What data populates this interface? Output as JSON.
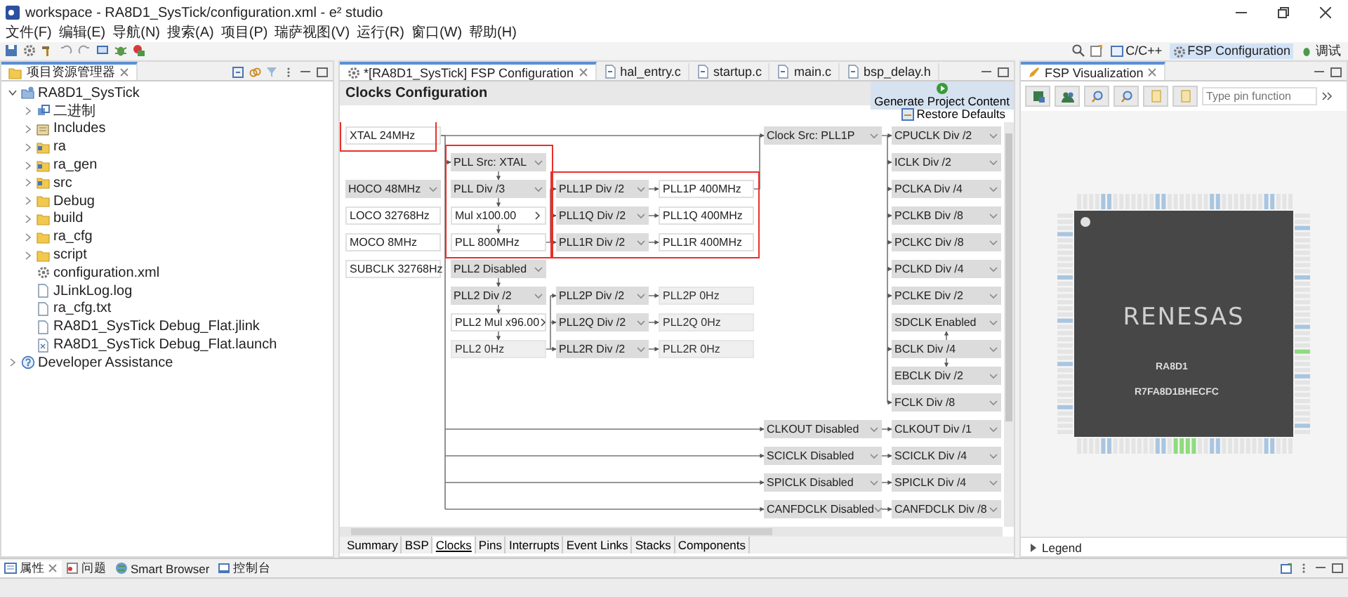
{
  "window": {
    "title": "workspace - RA8D1_SysTick/configuration.xml - e² studio"
  },
  "menu": [
    "文件(F)",
    "编辑(E)",
    "导航(N)",
    "搜索(A)",
    "项目(P)",
    "瑞萨视图(V)",
    "运行(R)",
    "窗口(W)",
    "帮助(H)"
  ],
  "perspectives": [
    {
      "label": "C/C++",
      "selected": false
    },
    {
      "label": "FSP Configuration",
      "selected": true
    },
    {
      "label": "调试",
      "selected": false
    }
  ],
  "explorer": {
    "title": "项目资源管理器",
    "tree": [
      {
        "label": "RA8D1_SysTick",
        "kind": "project",
        "expanded": true,
        "children": [
          {
            "label": "二进制",
            "kind": "binaries",
            "expanded": false
          },
          {
            "label": "Includes",
            "kind": "includes",
            "expanded": false
          },
          {
            "label": "ra",
            "kind": "source-folder",
            "expanded": false
          },
          {
            "label": "ra_gen",
            "kind": "source-folder",
            "expanded": false
          },
          {
            "label": "src",
            "kind": "source-folder",
            "expanded": false
          },
          {
            "label": "Debug",
            "kind": "folder",
            "expanded": false
          },
          {
            "label": "build",
            "kind": "folder",
            "expanded": false
          },
          {
            "label": "ra_cfg",
            "kind": "folder",
            "expanded": false
          },
          {
            "label": "script",
            "kind": "folder",
            "expanded": false
          },
          {
            "label": "configuration.xml",
            "kind": "config"
          },
          {
            "label": "JLinkLog.log",
            "kind": "file"
          },
          {
            "label": "ra_cfg.txt",
            "kind": "file"
          },
          {
            "label": "RA8D1_SysTick Debug_Flat.jlink",
            "kind": "file"
          },
          {
            "label": "RA8D1_SysTick Debug_Flat.launch",
            "kind": "launch"
          }
        ]
      },
      {
        "label": "Developer Assistance",
        "kind": "help",
        "expanded": false
      }
    ]
  },
  "editor": {
    "tabs": [
      {
        "label": "*[RA8D1_SysTick] FSP Configuration",
        "selected": true
      },
      {
        "label": "hal_entry.c",
        "selected": false
      },
      {
        "label": "startup.c",
        "selected": false
      },
      {
        "label": "main.c",
        "selected": false
      },
      {
        "label": "bsp_delay.h",
        "selected": false
      }
    ],
    "heading": "Clocks Configuration",
    "generate_button": "Generate Project Content",
    "restore_button": "Restore Defaults",
    "columns": [
      [
        {
          "label": "XTAL 24MHz",
          "kind": "value"
        },
        {
          "label": "HOCO 48MHz",
          "kind": "select"
        },
        {
          "label": "LOCO 32768Hz",
          "kind": "value"
        },
        {
          "label": "MOCO 8MHz",
          "kind": "value"
        },
        {
          "label": "SUBCLK 32768Hz",
          "kind": "value"
        }
      ],
      [
        {
          "label": "PLL Src: XTAL",
          "kind": "select"
        },
        {
          "label": "PLL Div /3",
          "kind": "select"
        },
        {
          "label": "Mul x100.00",
          "kind": "multiplier"
        },
        {
          "label": "PLL 800MHz",
          "kind": "value"
        },
        {
          "label": "PLL2 Disabled",
          "kind": "select"
        },
        {
          "label": "PLL2 Div /2",
          "kind": "select"
        },
        {
          "label": "PLL2 Mul x96.00",
          "kind": "multiplier"
        },
        {
          "label": "PLL2 0Hz",
          "kind": "inactive"
        }
      ],
      [
        {
          "label": "PLL1P Div /2",
          "kind": "select"
        },
        {
          "label": "PLL1Q Div /2",
          "kind": "select"
        },
        {
          "label": "PLL1R Div /2",
          "kind": "select"
        },
        {
          "label": "PLL2P Div /2",
          "kind": "select"
        },
        {
          "label": "PLL2Q Div /2",
          "kind": "select"
        },
        {
          "label": "PLL2R Div /2",
          "kind": "select"
        }
      ],
      [
        {
          "label": "PLL1P 400MHz",
          "kind": "value"
        },
        {
          "label": "PLL1Q 400MHz",
          "kind": "value"
        },
        {
          "label": "PLL1R 400MHz",
          "kind": "value"
        },
        {
          "label": "PLL2P 0Hz",
          "kind": "inactive"
        },
        {
          "label": "PLL2Q 0Hz",
          "kind": "inactive"
        },
        {
          "label": "PLL2R 0Hz",
          "kind": "inactive"
        }
      ],
      [
        {
          "label": "Clock Src: PLL1P",
          "kind": "select"
        },
        {
          "label": "CLKOUT Disabled",
          "kind": "select"
        },
        {
          "label": "SCICLK Disabled",
          "kind": "select"
        },
        {
          "label": "SPICLK Disabled",
          "kind": "select"
        },
        {
          "label": "CANFDCLK Disabled",
          "kind": "select"
        }
      ],
      [
        {
          "label": "CPUCLK Div /2",
          "kind": "select"
        },
        {
          "label": "ICLK Div /2",
          "kind": "select"
        },
        {
          "label": "PCLKA Div /4",
          "kind": "select"
        },
        {
          "label": "PCLKB Div /8",
          "kind": "select"
        },
        {
          "label": "PCLKC Div /8",
          "kind": "select"
        },
        {
          "label": "PCLKD Div /4",
          "kind": "select"
        },
        {
          "label": "PCLKE Div /2",
          "kind": "select"
        },
        {
          "label": "SDCLK Enabled",
          "kind": "select"
        },
        {
          "label": "BCLK Div /4",
          "kind": "select"
        },
        {
          "label": "EBCLK Div /2",
          "kind": "select"
        },
        {
          "label": "FCLK Div /8",
          "kind": "select"
        },
        {
          "label": "CLKOUT Div /1",
          "kind": "select"
        },
        {
          "label": "SCICLK Div /4",
          "kind": "select"
        },
        {
          "label": "SPICLK Div /4",
          "kind": "select"
        },
        {
          "label": "CANFDCLK Div /8",
          "kind": "select"
        }
      ]
    ],
    "page_tabs": [
      {
        "label": "Summary",
        "selected": false
      },
      {
        "label": "BSP",
        "selected": false
      },
      {
        "label": "Clocks",
        "selected": true
      },
      {
        "label": "Pins",
        "selected": false
      },
      {
        "label": "Interrupts",
        "selected": false
      },
      {
        "label": "Event Links",
        "selected": false
      },
      {
        "label": "Stacks",
        "selected": false
      },
      {
        "label": "Components",
        "selected": false
      }
    ]
  },
  "visualization": {
    "title": "FSP Visualization",
    "search": {
      "placeholder": "Type pin function"
    },
    "chip": {
      "logo": "RENESAS",
      "name": "RA8D1",
      "part": "R7FA8D1BHECFC"
    },
    "legend": {
      "label": "Legend",
      "expanded": false
    }
  },
  "bottom_tabs": [
    {
      "label": "属性",
      "selected": true
    },
    {
      "label": "问题",
      "selected": false
    },
    {
      "label": "Smart Browser",
      "selected": false
    },
    {
      "label": "控制台",
      "selected": false
    }
  ]
}
